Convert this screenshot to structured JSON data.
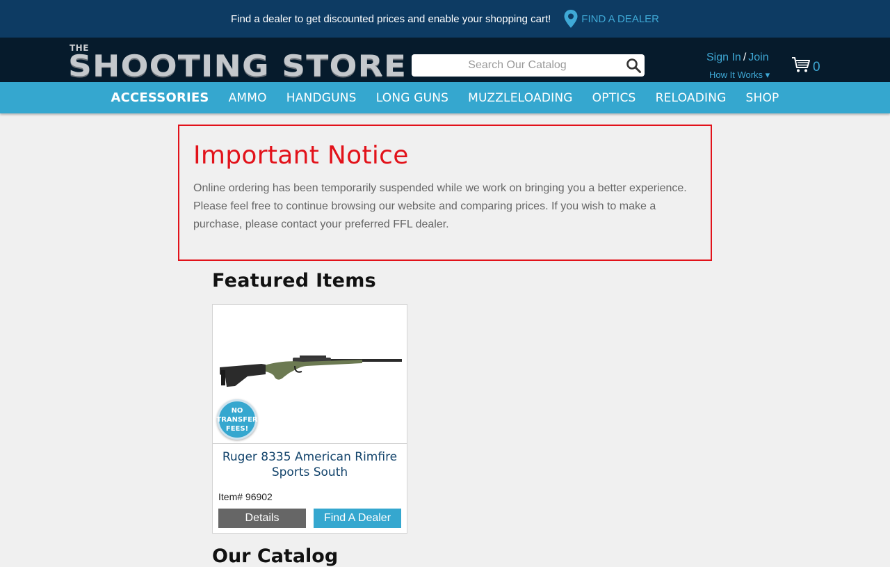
{
  "topbar": {
    "message": "Find a dealer to get discounted prices and enable your shopping cart!",
    "dealer_link": "FIND A DEALER",
    "pin_icon": "map-pin-icon"
  },
  "header": {
    "logo_the": "THE",
    "logo_main": "SHOOTING STORE",
    "search_placeholder": "Search Our Catalog",
    "sign_in": "Sign In",
    "separator": "/",
    "join": "Join",
    "how_it_works": "How It Works ▾",
    "cart_count": "0"
  },
  "nav": {
    "items": [
      {
        "label": "ACCESSORIES"
      },
      {
        "label": "AMMO"
      },
      {
        "label": "HANDGUNS"
      },
      {
        "label": "LONG GUNS"
      },
      {
        "label": "MUZZLELOADING"
      },
      {
        "label": "OPTICS"
      },
      {
        "label": "RELOADING"
      },
      {
        "label": "SHOP"
      }
    ]
  },
  "notice": {
    "title": "Important Notice",
    "body": "Online ordering has been temporarily suspended while we work on bringing you a better experience. Please feel free to continue browsing our website and comparing prices. If you wish to make a purchase, please contact your preferred FFL dealer."
  },
  "featured": {
    "title": "Featured Items",
    "product": {
      "badge_line1": "NO",
      "badge_line2": "TRANSFER",
      "badge_line3": "FEES!",
      "name": "Ruger 8335 American Rimfire Sports South",
      "item_number": "Item# 96902",
      "details_label": "Details",
      "dealer_label": "Find A Dealer"
    }
  },
  "next_section_title": "Our Catalog",
  "colors": {
    "topbar_bg": "#0d3b63",
    "header_bg": "#061b2c",
    "nav_bg": "#35a7cf",
    "accent": "#3fa9d6",
    "notice_red": "#e2121a"
  }
}
